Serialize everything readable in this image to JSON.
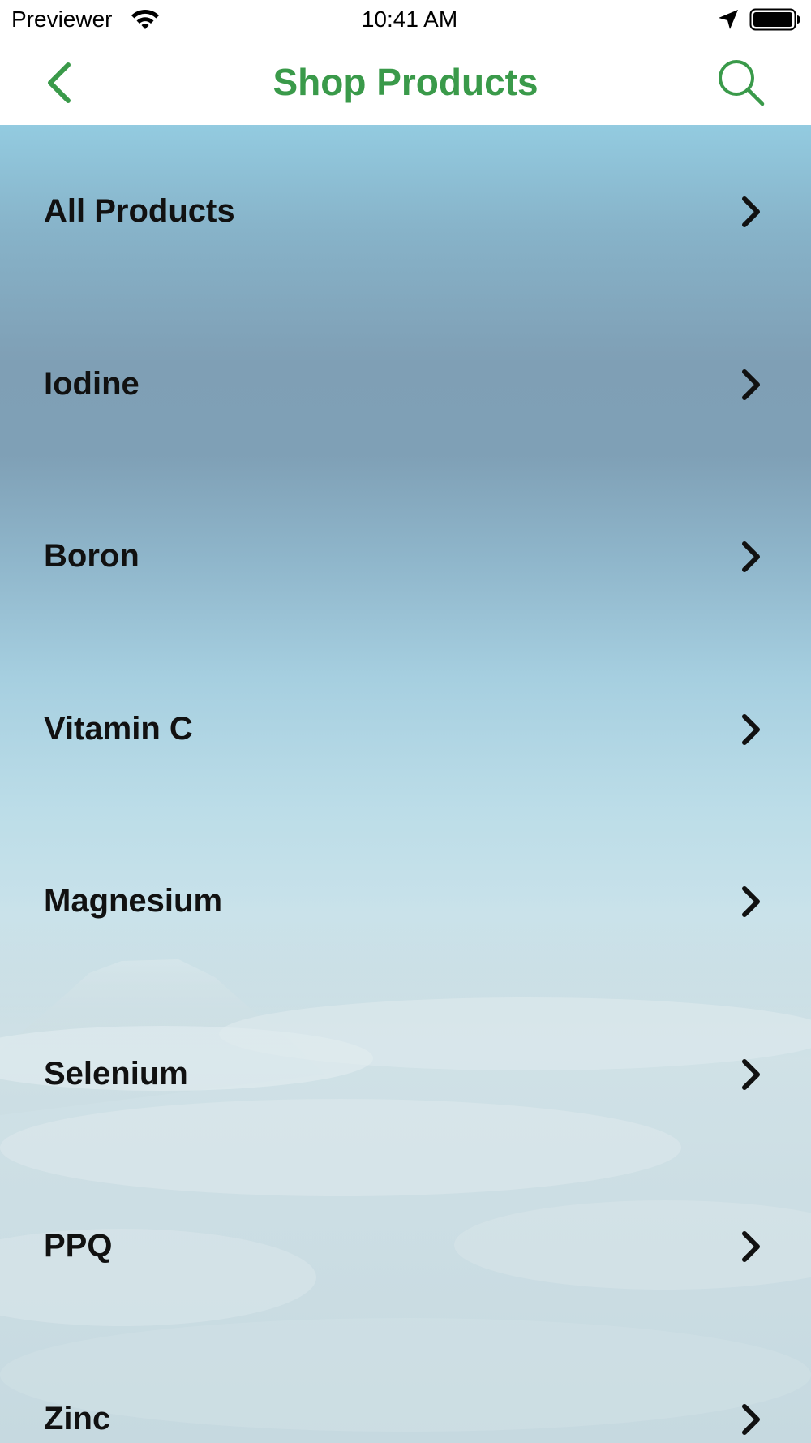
{
  "status_bar": {
    "carrier": "Previewer",
    "time": "10:41 AM",
    "icons": [
      "wifi-icon",
      "location-arrow-icon",
      "battery-icon"
    ]
  },
  "nav_bar": {
    "title": "Shop Products",
    "back_icon": "chevron-left-icon",
    "search_icon": "search-icon",
    "accent_color": "#3a9a4a"
  },
  "products": [
    {
      "label": "All Products"
    },
    {
      "label": "Iodine"
    },
    {
      "label": "Boron"
    },
    {
      "label": "Vitamin C"
    },
    {
      "label": "Magnesium"
    },
    {
      "label": "Selenium"
    },
    {
      "label": "PPQ"
    },
    {
      "label": "Zinc"
    }
  ],
  "row_icon": "chevron-right-icon"
}
